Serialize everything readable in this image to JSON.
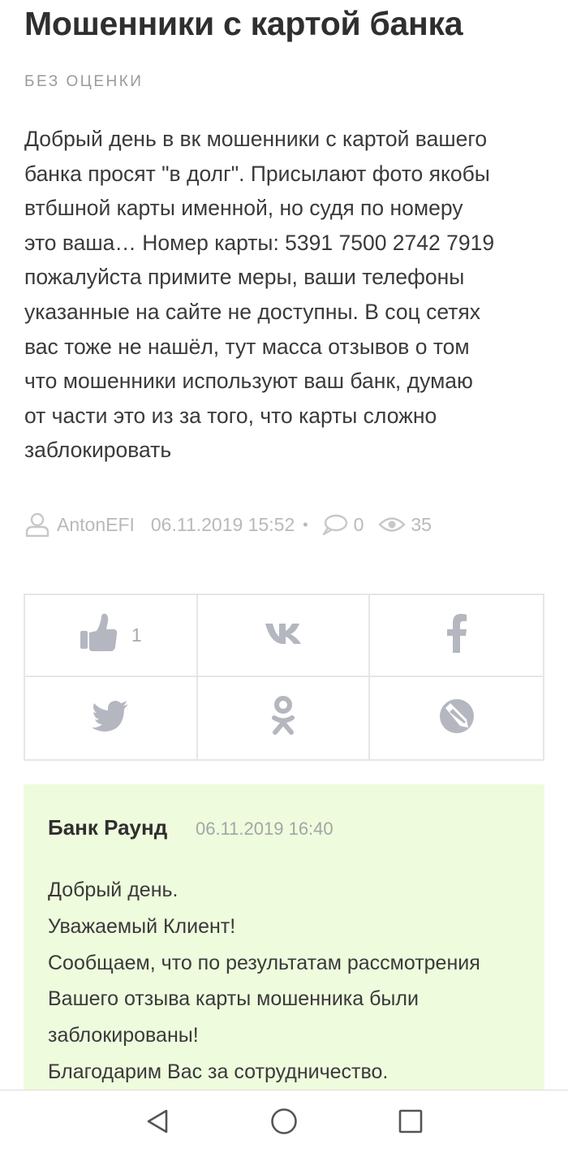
{
  "review": {
    "title": "Мошенники с картой банка",
    "rating_label": "БЕЗ ОЦЕНКИ",
    "text_lines": [
      "Добрый день в вк мошенники с картой вашего",
      "банка просят \"в долг\". Присылают фото якобы",
      "втбшной карты именной, но судя по номеру",
      "это ваша… Номер карты: 5391 7500 2742 7919",
      "пожалуйста примите меры, ваши телефоны",
      "указанные на сайте не доступны. В соц сетях",
      "вас тоже не нашёл, тут масса отзывов о том",
      "что мошенники используют ваш банк, думаю",
      "от части это из за того, что карты сложно",
      "заблокировать"
    ]
  },
  "meta": {
    "author": "AntonEFI",
    "datetime": "06.11.2019 15:52",
    "separator": "•",
    "comments_count": "0",
    "views_count": "35",
    "icons": [
      "user-icon",
      "comment-icon",
      "eye-icon"
    ]
  },
  "share": {
    "like_count": "1",
    "buttons": [
      "like",
      "vk",
      "facebook",
      "twitter",
      "odnoklassniki",
      "livejournal"
    ],
    "icon_color": "#b4b7bf"
  },
  "reply": {
    "author": "Банк Раунд",
    "datetime": "06.11.2019 16:40",
    "background": "#eefbdd",
    "text_lines": [
      "Добрый день.",
      "Уважаемый Клиент!",
      "Сообщаем, что по результатам рассмотрения",
      "Вашего отзыва карты мошенника были",
      "заблокированы!",
      "Благодарим Вас за сотрудничество."
    ]
  },
  "navbar": {
    "buttons": [
      "back",
      "home",
      "recents"
    ]
  }
}
